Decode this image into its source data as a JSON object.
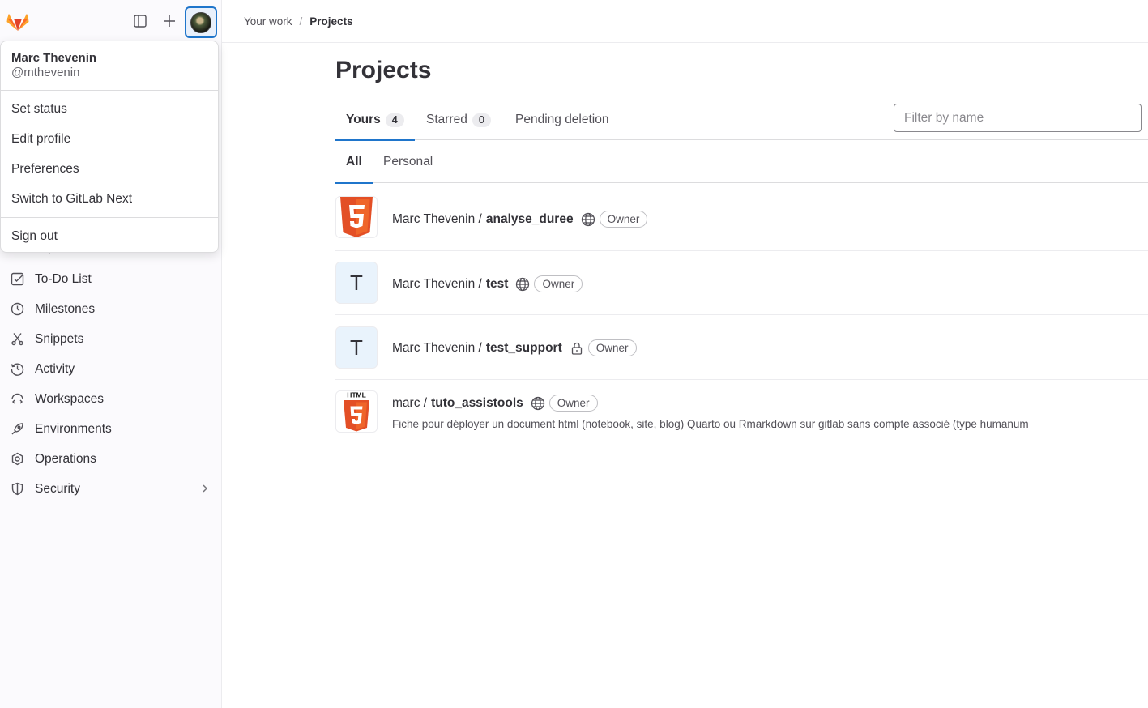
{
  "sidebar": {
    "partial_item_label": "Merge requests",
    "nav_items": [
      {
        "label": "To-Do List",
        "icon": "todo-icon"
      },
      {
        "label": "Milestones",
        "icon": "clock-icon"
      },
      {
        "label": "Snippets",
        "icon": "scissors-icon"
      },
      {
        "label": "Activity",
        "icon": "history-icon"
      },
      {
        "label": "Workspaces",
        "icon": "workspace-icon"
      },
      {
        "label": "Environments",
        "icon": "rocket-icon"
      },
      {
        "label": "Operations",
        "icon": "operations-icon"
      },
      {
        "label": "Security",
        "icon": "shield-icon"
      }
    ]
  },
  "user_menu": {
    "name": "Marc Thevenin",
    "handle": "@mthevenin",
    "items": [
      "Set status",
      "Edit profile",
      "Preferences",
      "Switch to GitLab Next"
    ],
    "sign_out": "Sign out"
  },
  "breadcrumb": {
    "parent": "Your work",
    "separator": "/",
    "current": "Projects"
  },
  "page": {
    "title": "Projects",
    "tabs": [
      {
        "label": "Yours",
        "count": "4"
      },
      {
        "label": "Starred",
        "count": "0"
      },
      {
        "label": "Pending deletion"
      }
    ],
    "filter_placeholder": "Filter by name",
    "subtabs": [
      "All",
      "Personal"
    ]
  },
  "projects": [
    {
      "namespace": "Marc Thevenin /",
      "name": "analyse_duree",
      "visibility": "public",
      "role": "Owner",
      "avatar": "html5",
      "letter": "",
      "description": ""
    },
    {
      "namespace": "Marc Thevenin /",
      "name": "test",
      "visibility": "public",
      "role": "Owner",
      "avatar": "letter",
      "letter": "T",
      "description": ""
    },
    {
      "namespace": "Marc Thevenin /",
      "name": "test_support",
      "visibility": "private",
      "role": "Owner",
      "avatar": "letter",
      "letter": "T",
      "description": ""
    },
    {
      "namespace": "marc /",
      "name": "tuto_assistools",
      "visibility": "public",
      "role": "Owner",
      "avatar": "html5-text",
      "letter": "",
      "description": "Fiche pour déployer un document html (notebook, site, blog) Quarto ou Rmarkdown sur gitlab sans compte associé (type humanum"
    }
  ],
  "html5_logo_text": "HTML",
  "colors": {
    "accent": "#1f75cb",
    "gitlab_orange": "#fc6d26",
    "html5": "#e34f26"
  }
}
